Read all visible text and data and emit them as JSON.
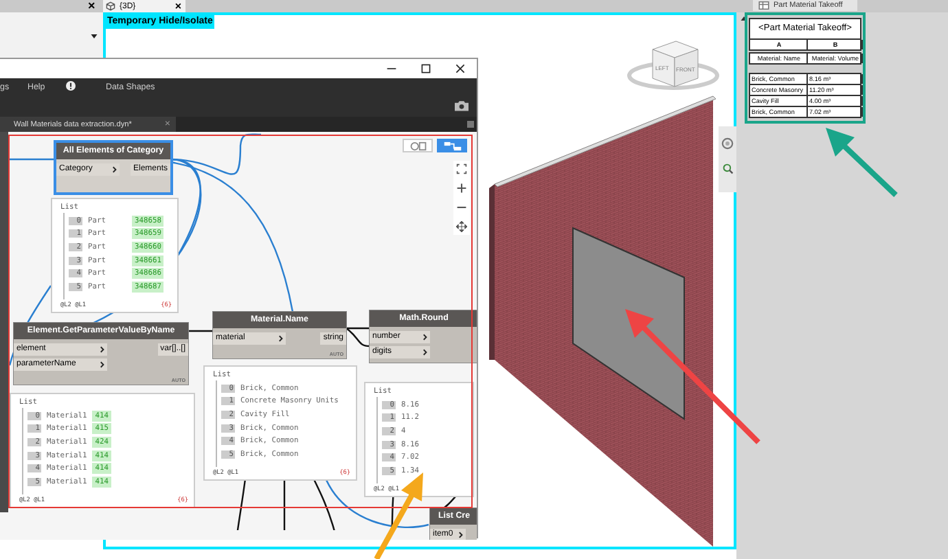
{
  "revit": {
    "side_tab": {
      "close": "×"
    },
    "view_tab": {
      "label": "{3D}",
      "close": "×"
    },
    "view_label": "Temporary Hide/Isolate",
    "viewcube": {
      "faces": [
        "LEFT",
        "FRONT"
      ]
    }
  },
  "schedule": {
    "tab": "Part Material Takeoff",
    "title": "<Part Material Takeoff>",
    "column_letters": [
      "A",
      "B"
    ],
    "headers": [
      "Material: Name",
      "Material: Volume"
    ],
    "rows": [
      [
        "Brick, Common",
        "8.16 m³"
      ],
      [
        "Concrete Masonry",
        "11.20 m³"
      ],
      [
        "Cavity Fill",
        "4.00 m³"
      ],
      [
        "Brick, Common",
        "7.02 m³"
      ]
    ]
  },
  "dynamo": {
    "menu": [
      "gs",
      "Help",
      "Data Shapes"
    ],
    "file_tab": {
      "label": "Wall Materials data extraction.dyn*",
      "close": "×"
    },
    "view_toggles": [
      {
        "selected": false
      },
      {
        "selected": true
      }
    ],
    "nodes": [
      {
        "title": "All Elements of Category",
        "inputs": [
          "Category"
        ],
        "outputs": [
          "Elements"
        ],
        "selected": true
      },
      {
        "title": "Element.GetParameterValueByName",
        "inputs": [
          "element",
          "parameterName"
        ],
        "outputs": [
          "var[]..[]"
        ],
        "lacing": "AUTO",
        "selected": false
      },
      {
        "title": "Material.Name",
        "inputs": [
          "material"
        ],
        "outputs": [
          "string"
        ],
        "lacing": "AUTO",
        "selected": false
      },
      {
        "title": "Math.Round",
        "inputs": [
          "number",
          "digits"
        ],
        "selected": false
      },
      {
        "title": "List Cre",
        "inputs": [
          "item0"
        ],
        "selected": false
      }
    ],
    "previews": [
      {
        "header": "List",
        "items": [
          {
            "index": "0",
            "text": "Part",
            "value": "348658"
          },
          {
            "index": "1",
            "text": "Part",
            "value": "348659"
          },
          {
            "index": "2",
            "text": "Part",
            "value": "348660"
          },
          {
            "index": "3",
            "text": "Part",
            "value": "348661"
          },
          {
            "index": "4",
            "text": "Part",
            "value": "348686"
          },
          {
            "index": "5",
            "text": "Part",
            "value": "348687"
          }
        ],
        "footer": "@L2 @L1",
        "count": "{6}"
      },
      {
        "header": "List",
        "items": [
          {
            "index": "0",
            "text": "Material1",
            "value": "414"
          },
          {
            "index": "1",
            "text": "Material1",
            "value": "415"
          },
          {
            "index": "2",
            "text": "Material1",
            "value": "424"
          },
          {
            "index": "3",
            "text": "Material1",
            "value": "414"
          },
          {
            "index": "4",
            "text": "Material1",
            "value": "414"
          },
          {
            "index": "5",
            "text": "Material1",
            "value": "414"
          }
        ],
        "footer": "@L2 @L1",
        "count": "{6}"
      },
      {
        "header": "List",
        "items": [
          {
            "index": "0",
            "text": "Brick, Common"
          },
          {
            "index": "1",
            "text": "Concrete Masonry Units"
          },
          {
            "index": "2",
            "text": "Cavity Fill"
          },
          {
            "index": "3",
            "text": "Brick, Common"
          },
          {
            "index": "4",
            "text": "Brick, Common"
          },
          {
            "index": "5",
            "text": "Brick, Common"
          }
        ],
        "footer": "@L2 @L1",
        "count": "{6}"
      },
      {
        "header": "List",
        "items": [
          {
            "index": "0",
            "text": "8.16"
          },
          {
            "index": "1",
            "text": "11.2"
          },
          {
            "index": "2",
            "text": "4"
          },
          {
            "index": "3",
            "text": "8.16"
          },
          {
            "index": "4",
            "text": "7.02"
          },
          {
            "index": "5",
            "text": "1.34"
          }
        ],
        "footer": "@L2 @L1"
      }
    ]
  }
}
